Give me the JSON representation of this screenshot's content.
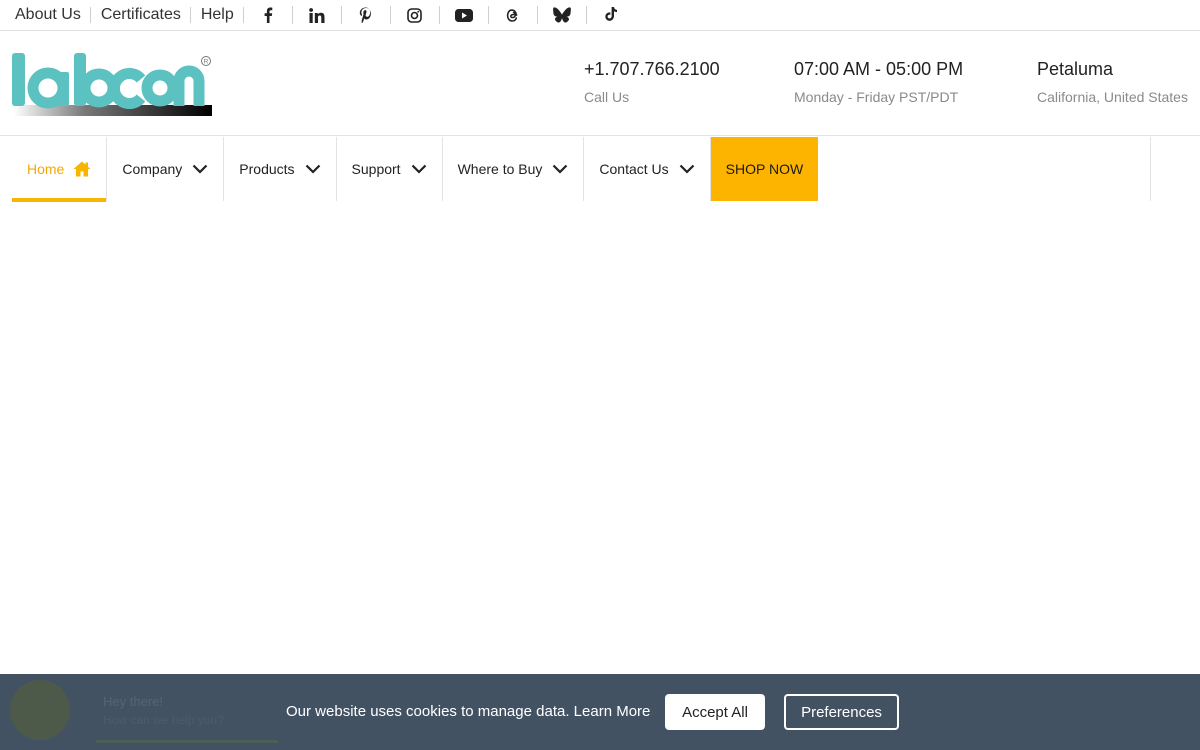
{
  "topbar": {
    "links": [
      "About Us",
      "Certificates",
      "Help"
    ],
    "socials": [
      "facebook-icon",
      "linkedin-icon",
      "pinterest-icon",
      "instagram-icon",
      "youtube-icon",
      "threads-icon",
      "bluesky-icon",
      "tiktok-icon"
    ]
  },
  "brand": {
    "logo_text": "labcon",
    "accent": "#5cc1c1"
  },
  "header": {
    "phone": {
      "main": "+1.707.766.2100",
      "sub": "Call Us"
    },
    "hours": {
      "main": "07:00 AM - 05:00 PM",
      "sub": "Monday - Friday PST/PDT"
    },
    "location": {
      "main": "Petaluma",
      "sub": "California, United States"
    }
  },
  "nav": {
    "items": [
      "Home",
      "Company",
      "Products",
      "Support",
      "Where to Buy",
      "Contact Us"
    ],
    "shop": "SHOP NOW",
    "active_color": "#f5a800",
    "shop_color": "#fdb400"
  },
  "chat": {
    "title": "Hey there!",
    "subtitle": "How can we help you?"
  },
  "cookie": {
    "text": "Our website uses cookies to manage data.",
    "learn_more": "Learn More",
    "accept": "Accept All",
    "preferences": "Preferences",
    "bg": "#435263"
  }
}
